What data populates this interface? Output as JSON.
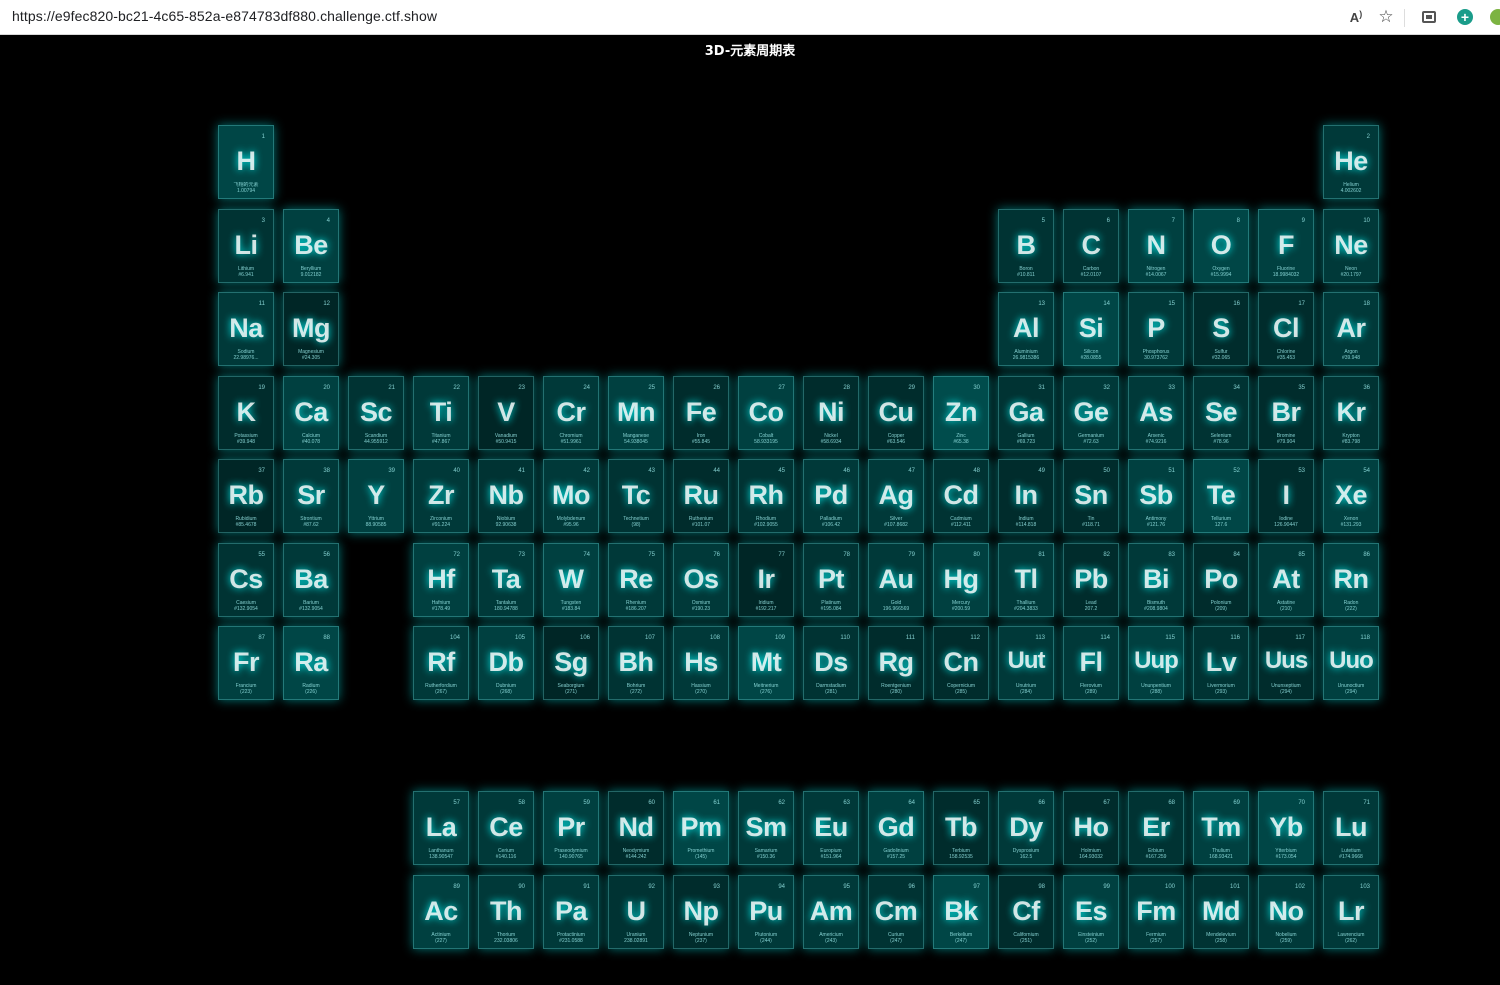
{
  "browser": {
    "url": "https://e9fec820-bc21-4c65-852a-e874783df880.challenge.ctf.show",
    "icons": [
      "read-aloud-icon",
      "favorite-star-icon",
      "collections-icon",
      "add-icon",
      "extension-icon"
    ]
  },
  "page": {
    "title": "3D-元素周期表"
  },
  "colors": {
    "background": "#000000",
    "tile_glow": "#00ffff"
  },
  "elements": [
    {
      "s": "H",
      "n": "1",
      "name": "飞翔的元素",
      "w": "1.00794",
      "c": 1,
      "r": 1,
      "a": 0.55
    },
    {
      "s": "He",
      "n": "2",
      "name": "Helium",
      "w": "4.002602",
      "c": 18,
      "r": 1,
      "a": 0.45
    },
    {
      "s": "Li",
      "n": "3",
      "name": "Lithium",
      "w": "#6.941",
      "c": 1,
      "r": 2,
      "a": 0.4
    },
    {
      "s": "Be",
      "n": "4",
      "name": "Beryllium",
      "w": "9.012182",
      "c": 2,
      "r": 2,
      "a": 0.5
    },
    {
      "s": "B",
      "n": "5",
      "name": "Boron",
      "w": "#10.811",
      "c": 13,
      "r": 2,
      "a": 0.4
    },
    {
      "s": "C",
      "n": "6",
      "name": "Carbon",
      "w": "#12.0107",
      "c": 14,
      "r": 2,
      "a": 0.4
    },
    {
      "s": "N",
      "n": "7",
      "name": "Nitrogen",
      "w": "#14.0067",
      "c": 15,
      "r": 2,
      "a": 0.5
    },
    {
      "s": "O",
      "n": "8",
      "name": "Oxygen",
      "w": "#15.9994",
      "c": 16,
      "r": 2,
      "a": 0.55
    },
    {
      "s": "F",
      "n": "9",
      "name": "Fluorine",
      "w": "18.9984032",
      "c": 17,
      "r": 2,
      "a": 0.5
    },
    {
      "s": "Ne",
      "n": "10",
      "name": "Neon",
      "w": "#20.1797",
      "c": 18,
      "r": 2,
      "a": 0.45
    },
    {
      "s": "Na",
      "n": "11",
      "name": "Sodium",
      "w": "22.98976...",
      "c": 1,
      "r": 3,
      "a": 0.45
    },
    {
      "s": "Mg",
      "n": "12",
      "name": "Magnesium",
      "w": "#24.305",
      "c": 2,
      "r": 3,
      "a": 0.3
    },
    {
      "s": "Al",
      "n": "13",
      "name": "Aluminium",
      "w": "26.9815386",
      "c": 13,
      "r": 3,
      "a": 0.45
    },
    {
      "s": "Si",
      "n": "14",
      "name": "Silicon",
      "w": "#28.0855",
      "c": 14,
      "r": 3,
      "a": 0.55
    },
    {
      "s": "P",
      "n": "15",
      "name": "Phosphorus",
      "w": "30.973762",
      "c": 15,
      "r": 3,
      "a": 0.45
    },
    {
      "s": "S",
      "n": "16",
      "name": "Sulfur",
      "w": "#32.065",
      "c": 16,
      "r": 3,
      "a": 0.35
    },
    {
      "s": "Cl",
      "n": "17",
      "name": "Chlorine",
      "w": "#35.453",
      "c": 17,
      "r": 3,
      "a": 0.35
    },
    {
      "s": "Ar",
      "n": "18",
      "name": "Argon",
      "w": "#39.948",
      "c": 18,
      "r": 3,
      "a": 0.45
    },
    {
      "s": "K",
      "n": "19",
      "name": "Potassium",
      "w": "#39.948",
      "c": 1,
      "r": 4,
      "a": 0.35
    },
    {
      "s": "Ca",
      "n": "20",
      "name": "Calcium",
      "w": "#40.078",
      "c": 2,
      "r": 4,
      "a": 0.5
    },
    {
      "s": "Sc",
      "n": "21",
      "name": "Scandium",
      "w": "44.955912",
      "c": 3,
      "r": 4,
      "a": 0.4
    },
    {
      "s": "Ti",
      "n": "22",
      "name": "Titanium",
      "w": "#47.867",
      "c": 4,
      "r": 4,
      "a": 0.45
    },
    {
      "s": "V",
      "n": "23",
      "name": "Vanadium",
      "w": "#50.9415",
      "c": 5,
      "r": 4,
      "a": 0.3
    },
    {
      "s": "Cr",
      "n": "24",
      "name": "Chromium",
      "w": "#51.9961",
      "c": 6,
      "r": 4,
      "a": 0.45
    },
    {
      "s": "Mn",
      "n": "25",
      "name": "Manganese",
      "w": "54.938045",
      "c": 7,
      "r": 4,
      "a": 0.5
    },
    {
      "s": "Fe",
      "n": "26",
      "name": "Iron",
      "w": "#55.845",
      "c": 8,
      "r": 4,
      "a": 0.35
    },
    {
      "s": "Co",
      "n": "27",
      "name": "Cobalt",
      "w": "58.933195",
      "c": 9,
      "r": 4,
      "a": 0.5
    },
    {
      "s": "Ni",
      "n": "28",
      "name": "Nickel",
      "w": "#58.6934",
      "c": 10,
      "r": 4,
      "a": 0.35
    },
    {
      "s": "Cu",
      "n": "29",
      "name": "Copper",
      "w": "#63.546",
      "c": 11,
      "r": 4,
      "a": 0.35
    },
    {
      "s": "Zn",
      "n": "30",
      "name": "Zinc",
      "w": "#65.38",
      "c": 12,
      "r": 4,
      "a": 0.6
    },
    {
      "s": "Ga",
      "n": "31",
      "name": "Gallium",
      "w": "#69.723",
      "c": 13,
      "r": 4,
      "a": 0.4
    },
    {
      "s": "Ge",
      "n": "32",
      "name": "Germanium",
      "w": "#72.63",
      "c": 14,
      "r": 4,
      "a": 0.45
    },
    {
      "s": "As",
      "n": "33",
      "name": "Arsenic",
      "w": "#74.9216",
      "c": 15,
      "r": 4,
      "a": 0.45
    },
    {
      "s": "Se",
      "n": "34",
      "name": "Selenium",
      "w": "#78.96",
      "c": 16,
      "r": 4,
      "a": 0.4
    },
    {
      "s": "Br",
      "n": "35",
      "name": "Bromine",
      "w": "#79.904",
      "c": 17,
      "r": 4,
      "a": 0.35
    },
    {
      "s": "Kr",
      "n": "36",
      "name": "Krypton",
      "w": "#83.798",
      "c": 18,
      "r": 4,
      "a": 0.4
    },
    {
      "s": "Rb",
      "n": "37",
      "name": "Rubidium",
      "w": "#85.4678",
      "c": 1,
      "r": 5,
      "a": 0.3
    },
    {
      "s": "Sr",
      "n": "38",
      "name": "Strontium",
      "w": "#87.62",
      "c": 2,
      "r": 5,
      "a": 0.45
    },
    {
      "s": "Y",
      "n": "39",
      "name": "Yttrium",
      "w": "88.90585",
      "c": 3,
      "r": 5,
      "a": 0.5
    },
    {
      "s": "Zr",
      "n": "40",
      "name": "Zirconium",
      "w": "#91.224",
      "c": 4,
      "r": 5,
      "a": 0.45
    },
    {
      "s": "Nb",
      "n": "41",
      "name": "Niobium",
      "w": "92.90638",
      "c": 5,
      "r": 5,
      "a": 0.4
    },
    {
      "s": "Mo",
      "n": "42",
      "name": "Molybdenum",
      "w": "#95.96",
      "c": 6,
      "r": 5,
      "a": 0.45
    },
    {
      "s": "Tc",
      "n": "43",
      "name": "Technetium",
      "w": "(98)",
      "c": 7,
      "r": 5,
      "a": 0.4
    },
    {
      "s": "Ru",
      "n": "44",
      "name": "Ruthenium",
      "w": "#101.07",
      "c": 8,
      "r": 5,
      "a": 0.35
    },
    {
      "s": "Rh",
      "n": "45",
      "name": "Rhodium",
      "w": "#102.9055",
      "c": 9,
      "r": 5,
      "a": 0.4
    },
    {
      "s": "Pd",
      "n": "46",
      "name": "Palladium",
      "w": "#106.42",
      "c": 10,
      "r": 5,
      "a": 0.45
    },
    {
      "s": "Ag",
      "n": "47",
      "name": "Silver",
      "w": "#107.8682",
      "c": 11,
      "r": 5,
      "a": 0.45
    },
    {
      "s": "Cd",
      "n": "48",
      "name": "Cadmium",
      "w": "#112.411",
      "c": 12,
      "r": 5,
      "a": 0.4
    },
    {
      "s": "In",
      "n": "49",
      "name": "Indium",
      "w": "#114.818",
      "c": 13,
      "r": 5,
      "a": 0.35
    },
    {
      "s": "Sn",
      "n": "50",
      "name": "Tin",
      "w": "#118.71",
      "c": 14,
      "r": 5,
      "a": 0.35
    },
    {
      "s": "Sb",
      "n": "51",
      "name": "Antimony",
      "w": "#121.76",
      "c": 15,
      "r": 5,
      "a": 0.5
    },
    {
      "s": "Te",
      "n": "52",
      "name": "Tellurium",
      "w": "127.6",
      "c": 16,
      "r": 5,
      "a": 0.55
    },
    {
      "s": "I",
      "n": "53",
      "name": "Iodine",
      "w": "126.90447",
      "c": 17,
      "r": 5,
      "a": 0.35
    },
    {
      "s": "Xe",
      "n": "54",
      "name": "Xenon",
      "w": "#131.293",
      "c": 18,
      "r": 5,
      "a": 0.5
    },
    {
      "s": "Cs",
      "n": "55",
      "name": "Caesium",
      "w": "#132.9054",
      "c": 1,
      "r": 6,
      "a": 0.4
    },
    {
      "s": "Ba",
      "n": "56",
      "name": "Barium",
      "w": "#132.9054",
      "c": 2,
      "r": 6,
      "a": 0.45
    },
    {
      "s": "Hf",
      "n": "72",
      "name": "Hafnium",
      "w": "#178.49",
      "c": 4,
      "r": 6,
      "a": 0.5
    },
    {
      "s": "Ta",
      "n": "73",
      "name": "Tantalum",
      "w": "180.94788",
      "c": 5,
      "r": 6,
      "a": 0.45
    },
    {
      "s": "W",
      "n": "74",
      "name": "Tungsten",
      "w": "#183.84",
      "c": 6,
      "r": 6,
      "a": 0.5
    },
    {
      "s": "Re",
      "n": "75",
      "name": "Rhenium",
      "w": "#186.207",
      "c": 7,
      "r": 6,
      "a": 0.45
    },
    {
      "s": "Os",
      "n": "76",
      "name": "Osmium",
      "w": "#190.23",
      "c": 8,
      "r": 6,
      "a": 0.45
    },
    {
      "s": "Ir",
      "n": "77",
      "name": "Iridium",
      "w": "#192.217",
      "c": 9,
      "r": 6,
      "a": 0.3
    },
    {
      "s": "Pt",
      "n": "78",
      "name": "Platinum",
      "w": "#195.084",
      "c": 10,
      "r": 6,
      "a": 0.4
    },
    {
      "s": "Au",
      "n": "79",
      "name": "Gold",
      "w": "196.966569",
      "c": 11,
      "r": 6,
      "a": 0.45
    },
    {
      "s": "Hg",
      "n": "80",
      "name": "Mercury",
      "w": "#200.59",
      "c": 12,
      "r": 6,
      "a": 0.5
    },
    {
      "s": "Tl",
      "n": "81",
      "name": "Thallium",
      "w": "#204.3833",
      "c": 13,
      "r": 6,
      "a": 0.45
    },
    {
      "s": "Pb",
      "n": "82",
      "name": "Lead",
      "w": "207.2",
      "c": 14,
      "r": 6,
      "a": 0.35
    },
    {
      "s": "Bi",
      "n": "83",
      "name": "Bismuth",
      "w": "#208.9804",
      "c": 15,
      "r": 6,
      "a": 0.45
    },
    {
      "s": "Po",
      "n": "84",
      "name": "Polonium",
      "w": "(209)",
      "c": 16,
      "r": 6,
      "a": 0.35
    },
    {
      "s": "At",
      "n": "85",
      "name": "Astatine",
      "w": "(210)",
      "c": 17,
      "r": 6,
      "a": 0.45
    },
    {
      "s": "Rn",
      "n": "86",
      "name": "Radon",
      "w": "(222)",
      "c": 18,
      "r": 6,
      "a": 0.5
    },
    {
      "s": "Fr",
      "n": "87",
      "name": "Francium",
      "w": "(223)",
      "c": 1,
      "r": 7,
      "a": 0.5
    },
    {
      "s": "Ra",
      "n": "88",
      "name": "Radium",
      "w": "(226)",
      "c": 2,
      "r": 7,
      "a": 0.55
    },
    {
      "s": "Rf",
      "n": "104",
      "name": "Rutherfordium",
      "w": "(267)",
      "c": 4,
      "r": 7,
      "a": 0.45
    },
    {
      "s": "Db",
      "n": "105",
      "name": "Dubnium",
      "w": "(268)",
      "c": 5,
      "r": 7,
      "a": 0.5
    },
    {
      "s": "Sg",
      "n": "106",
      "name": "Seaborgium",
      "w": "(271)",
      "c": 6,
      "r": 7,
      "a": 0.3
    },
    {
      "s": "Bh",
      "n": "107",
      "name": "Bohrium",
      "w": "(272)",
      "c": 7,
      "r": 7,
      "a": 0.4
    },
    {
      "s": "Hs",
      "n": "108",
      "name": "Hassium",
      "w": "(270)",
      "c": 8,
      "r": 7,
      "a": 0.45
    },
    {
      "s": "Mt",
      "n": "109",
      "name": "Meitnerium",
      "w": "(276)",
      "c": 9,
      "r": 7,
      "a": 0.55
    },
    {
      "s": "Ds",
      "n": "110",
      "name": "Darmstadium",
      "w": "(281)",
      "c": 10,
      "r": 7,
      "a": 0.4
    },
    {
      "s": "Rg",
      "n": "111",
      "name": "Roentgenium",
      "w": "(280)",
      "c": 11,
      "r": 7,
      "a": 0.35
    },
    {
      "s": "Cn",
      "n": "112",
      "name": "Copernicium",
      "w": "(285)",
      "c": 12,
      "r": 7,
      "a": 0.35
    },
    {
      "s": "Uut",
      "n": "113",
      "name": "Unutrium",
      "w": "(284)",
      "c": 13,
      "r": 7,
      "a": 0.45
    },
    {
      "s": "Fl",
      "n": "114",
      "name": "Flerovium",
      "w": "(289)",
      "c": 14,
      "r": 7,
      "a": 0.45
    },
    {
      "s": "Uup",
      "n": "115",
      "name": "Ununpentium",
      "w": "(288)",
      "c": 15,
      "r": 7,
      "a": 0.5
    },
    {
      "s": "Lv",
      "n": "116",
      "name": "Livermorium",
      "w": "(293)",
      "c": 16,
      "r": 7,
      "a": 0.4
    },
    {
      "s": "Uus",
      "n": "117",
      "name": "Ununseptium",
      "w": "(294)",
      "c": 17,
      "r": 7,
      "a": 0.35
    },
    {
      "s": "Uuo",
      "n": "118",
      "name": "Ununoctium",
      "w": "(294)",
      "c": 18,
      "r": 7,
      "a": 0.5
    },
    {
      "s": "La",
      "n": "57",
      "name": "Lanthanum",
      "w": "138.90547",
      "c": 4,
      "r": 9,
      "a": 0.45
    },
    {
      "s": "Ce",
      "n": "58",
      "name": "Cerium",
      "w": "#140.116",
      "c": 5,
      "r": 9,
      "a": 0.45
    },
    {
      "s": "Pr",
      "n": "59",
      "name": "Praseodymium",
      "w": "140.90765",
      "c": 6,
      "r": 9,
      "a": 0.5
    },
    {
      "s": "Nd",
      "n": "60",
      "name": "Neodymium",
      "w": "#144.242",
      "c": 7,
      "r": 9,
      "a": 0.35
    },
    {
      "s": "Pm",
      "n": "61",
      "name": "Promethium",
      "w": "(145)",
      "c": 8,
      "r": 9,
      "a": 0.55
    },
    {
      "s": "Sm",
      "n": "62",
      "name": "Samarium",
      "w": "#150.36",
      "c": 9,
      "r": 9,
      "a": 0.45
    },
    {
      "s": "Eu",
      "n": "63",
      "name": "Europium",
      "w": "#151.964",
      "c": 10,
      "r": 9,
      "a": 0.45
    },
    {
      "s": "Gd",
      "n": "64",
      "name": "Gadolinium",
      "w": "#157.25",
      "c": 11,
      "r": 9,
      "a": 0.5
    },
    {
      "s": "Tb",
      "n": "65",
      "name": "Terbium",
      "w": "158.92535",
      "c": 12,
      "r": 9,
      "a": 0.35
    },
    {
      "s": "Dy",
      "n": "66",
      "name": "Dysprosium",
      "w": "162.5",
      "c": 13,
      "r": 9,
      "a": 0.45
    },
    {
      "s": "Ho",
      "n": "67",
      "name": "Holmium",
      "w": "164.93032",
      "c": 14,
      "r": 9,
      "a": 0.35
    },
    {
      "s": "Er",
      "n": "68",
      "name": "Erbium",
      "w": "#167.259",
      "c": 15,
      "r": 9,
      "a": 0.4
    },
    {
      "s": "Tm",
      "n": "69",
      "name": "Thulium",
      "w": "168.93421",
      "c": 16,
      "r": 9,
      "a": 0.5
    },
    {
      "s": "Yb",
      "n": "70",
      "name": "Ytterbium",
      "w": "#173.054",
      "c": 17,
      "r": 9,
      "a": 0.55
    },
    {
      "s": "Lu",
      "n": "71",
      "name": "Lutetium",
      "w": "#174.9668",
      "c": 18,
      "r": 9,
      "a": 0.45
    },
    {
      "s": "Ac",
      "n": "89",
      "name": "Actinium",
      "w": "(227)",
      "c": 4,
      "r": 10,
      "a": 0.5
    },
    {
      "s": "Th",
      "n": "90",
      "name": "Thorium",
      "w": "232.03806",
      "c": 5,
      "r": 10,
      "a": 0.45
    },
    {
      "s": "Pa",
      "n": "91",
      "name": "Protactinium",
      "w": "#231.0588",
      "c": 6,
      "r": 10,
      "a": 0.45
    },
    {
      "s": "U",
      "n": "92",
      "name": "Uranium",
      "w": "238.02891",
      "c": 7,
      "r": 10,
      "a": 0.4
    },
    {
      "s": "Np",
      "n": "93",
      "name": "Neptunium",
      "w": "(237)",
      "c": 8,
      "r": 10,
      "a": 0.35
    },
    {
      "s": "Pu",
      "n": "94",
      "name": "Plutonium",
      "w": "(244)",
      "c": 9,
      "r": 10,
      "a": 0.45
    },
    {
      "s": "Am",
      "n": "95",
      "name": "Americium",
      "w": "(243)",
      "c": 10,
      "r": 10,
      "a": 0.45
    },
    {
      "s": "Cm",
      "n": "96",
      "name": "Curium",
      "w": "(247)",
      "c": 11,
      "r": 10,
      "a": 0.4
    },
    {
      "s": "Bk",
      "n": "97",
      "name": "Berkelium",
      "w": "(247)",
      "c": 12,
      "r": 10,
      "a": 0.55
    },
    {
      "s": "Cf",
      "n": "98",
      "name": "Californium",
      "w": "(251)",
      "c": 13,
      "r": 10,
      "a": 0.35
    },
    {
      "s": "Es",
      "n": "99",
      "name": "Einsteinium",
      "w": "(252)",
      "c": 14,
      "r": 10,
      "a": 0.5
    },
    {
      "s": "Fm",
      "n": "100",
      "name": "Fermium",
      "w": "(257)",
      "c": 15,
      "r": 10,
      "a": 0.45
    },
    {
      "s": "Md",
      "n": "101",
      "name": "Mendelevium",
      "w": "(258)",
      "c": 16,
      "r": 10,
      "a": 0.4
    },
    {
      "s": "No",
      "n": "102",
      "name": "Nobelium",
      "w": "(259)",
      "c": 17,
      "r": 10,
      "a": 0.45
    },
    {
      "s": "Lr",
      "n": "103",
      "name": "Lawrencium",
      "w": "(262)",
      "c": 18,
      "r": 10,
      "a": 0.45
    }
  ]
}
